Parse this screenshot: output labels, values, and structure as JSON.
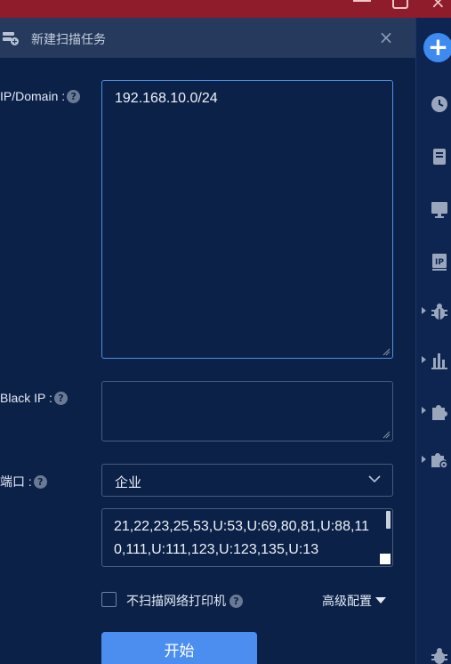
{
  "dialog": {
    "title": "新建扫描任务",
    "close_glyph": "×"
  },
  "form": {
    "ip_label": "IP/Domain :",
    "ip_value": "192.168.10.0/24",
    "black_ip_label": "Black IP :",
    "black_ip_value": "",
    "port_label": "端口 :",
    "port_preset": "企业",
    "ports_value": "21,22,23,25,53,U:53,U:69,80,81,U:88,110,111,U:111,123,U:123,135,U:13",
    "skip_printer_label": "不扫描网络打印机",
    "skip_printer_checked": false,
    "advanced_label": "高级配置",
    "start_label": "开始"
  },
  "icons": {
    "help": "help-circle-icon",
    "dialog": "new-task-icon",
    "close": "close-icon",
    "chevron": "chevron-down-icon"
  },
  "sidebar": {
    "items": [
      {
        "icon": "plus-icon"
      },
      {
        "icon": "clock-icon"
      },
      {
        "icon": "document-icon"
      },
      {
        "icon": "monitor-icon"
      },
      {
        "icon": "ip-icon",
        "text": "IP"
      },
      {
        "icon": "bug-icon"
      },
      {
        "icon": "bar-chart-icon"
      },
      {
        "icon": "puzzle-icon"
      },
      {
        "icon": "puzzle-gear-icon"
      },
      {
        "icon": "bug-icon"
      }
    ]
  },
  "colors": {
    "background": "#0c2148",
    "header": "#253a5c",
    "titlebar": "#8e1c2a",
    "accent": "#4c8df0",
    "border": "#4a5c7a"
  }
}
